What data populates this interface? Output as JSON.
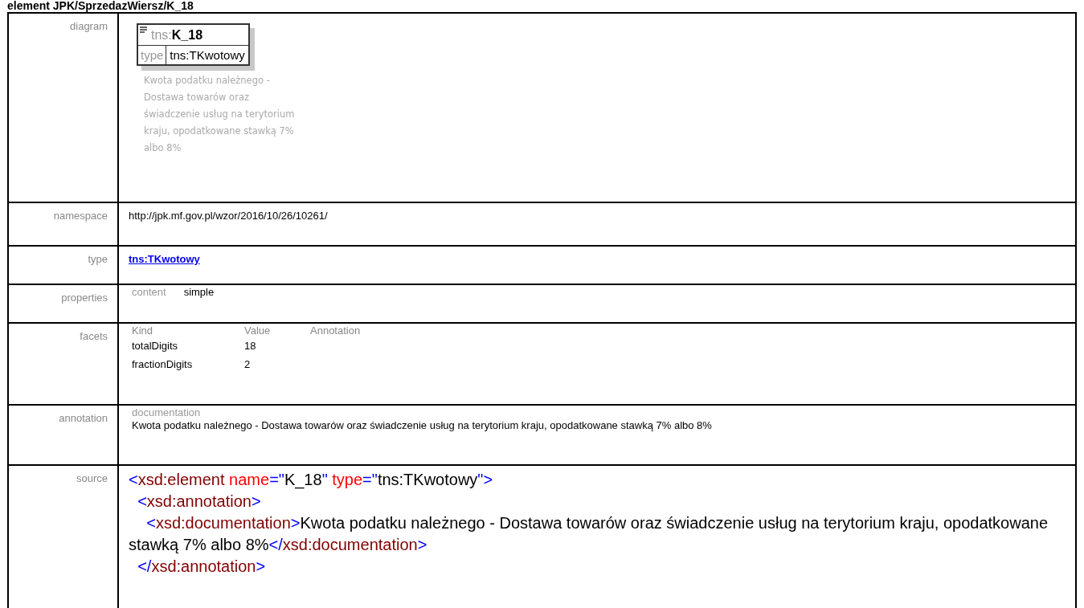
{
  "heading": "element JPK/SprzedazWiersz/K_18",
  "diagram": {
    "label": "diagram",
    "prefix": "tns:",
    "name": "K_18",
    "type_label": "type",
    "type_value": "tns:TKwotowy",
    "description": "Kwota podatku należnego - Dostawa towarów oraz świadczenie usług na terytorium kraju, opodatkowane stawką 7% albo 8%"
  },
  "namespace": {
    "label": "namespace",
    "value": "http://jpk.mf.gov.pl/wzor/2016/10/26/10261/"
  },
  "type": {
    "label": "type",
    "link": "tns:TKwotowy"
  },
  "properties": {
    "label": "properties",
    "key": "content",
    "value": "simple"
  },
  "facets": {
    "label": "facets",
    "columns": [
      "Kind",
      "Value",
      "Annotation"
    ],
    "rows": [
      [
        "totalDigits",
        "18"
      ],
      [
        "fractionDigits",
        "2"
      ]
    ]
  },
  "annotation": {
    "label": "annotation",
    "key": "documentation",
    "text": "Kwota podatku należnego - Dostawa towarów oraz świadczenie usług na terytorium kraju, opodatkowane stawką 7% albo 8%"
  },
  "source": {
    "label": "source",
    "lines": [
      [
        {
          "kind": "punct",
          "text": "<"
        },
        {
          "kind": "tag",
          "text": "xsd:element"
        },
        {
          "kind": "attr",
          "text": " name"
        },
        {
          "kind": "punct",
          "text": "=\""
        },
        {
          "kind": "text",
          "text": "K_18"
        },
        {
          "kind": "punct",
          "text": "\""
        },
        {
          "kind": "attr",
          "text": " type"
        },
        {
          "kind": "punct",
          "text": "=\""
        },
        {
          "kind": "text",
          "text": "tns:TKwotowy"
        },
        {
          "kind": "punct",
          "text": "\">"
        }
      ],
      [
        {
          "kind": "punct",
          "text": "  <"
        },
        {
          "kind": "tag",
          "text": "xsd:annotation"
        },
        {
          "kind": "punct",
          "text": ">"
        }
      ],
      [
        {
          "kind": "punct",
          "text": "    <"
        },
        {
          "kind": "tag",
          "text": "xsd:documentation"
        },
        {
          "kind": "punct",
          "text": ">"
        },
        {
          "kind": "text",
          "text": "Kwota podatku należnego - Dostawa towarów oraz świadczenie usług na terytorium kraju, opodatkowane stawką 7% albo 8%"
        },
        {
          "kind": "punct",
          "text": "</"
        },
        {
          "kind": "tag",
          "text": "xsd:documentation"
        },
        {
          "kind": "punct",
          "text": ">"
        }
      ],
      [
        {
          "kind": "punct",
          "text": "  </"
        },
        {
          "kind": "tag",
          "text": "xsd:annotation"
        },
        {
          "kind": "punct",
          "text": ">"
        }
      ]
    ]
  }
}
